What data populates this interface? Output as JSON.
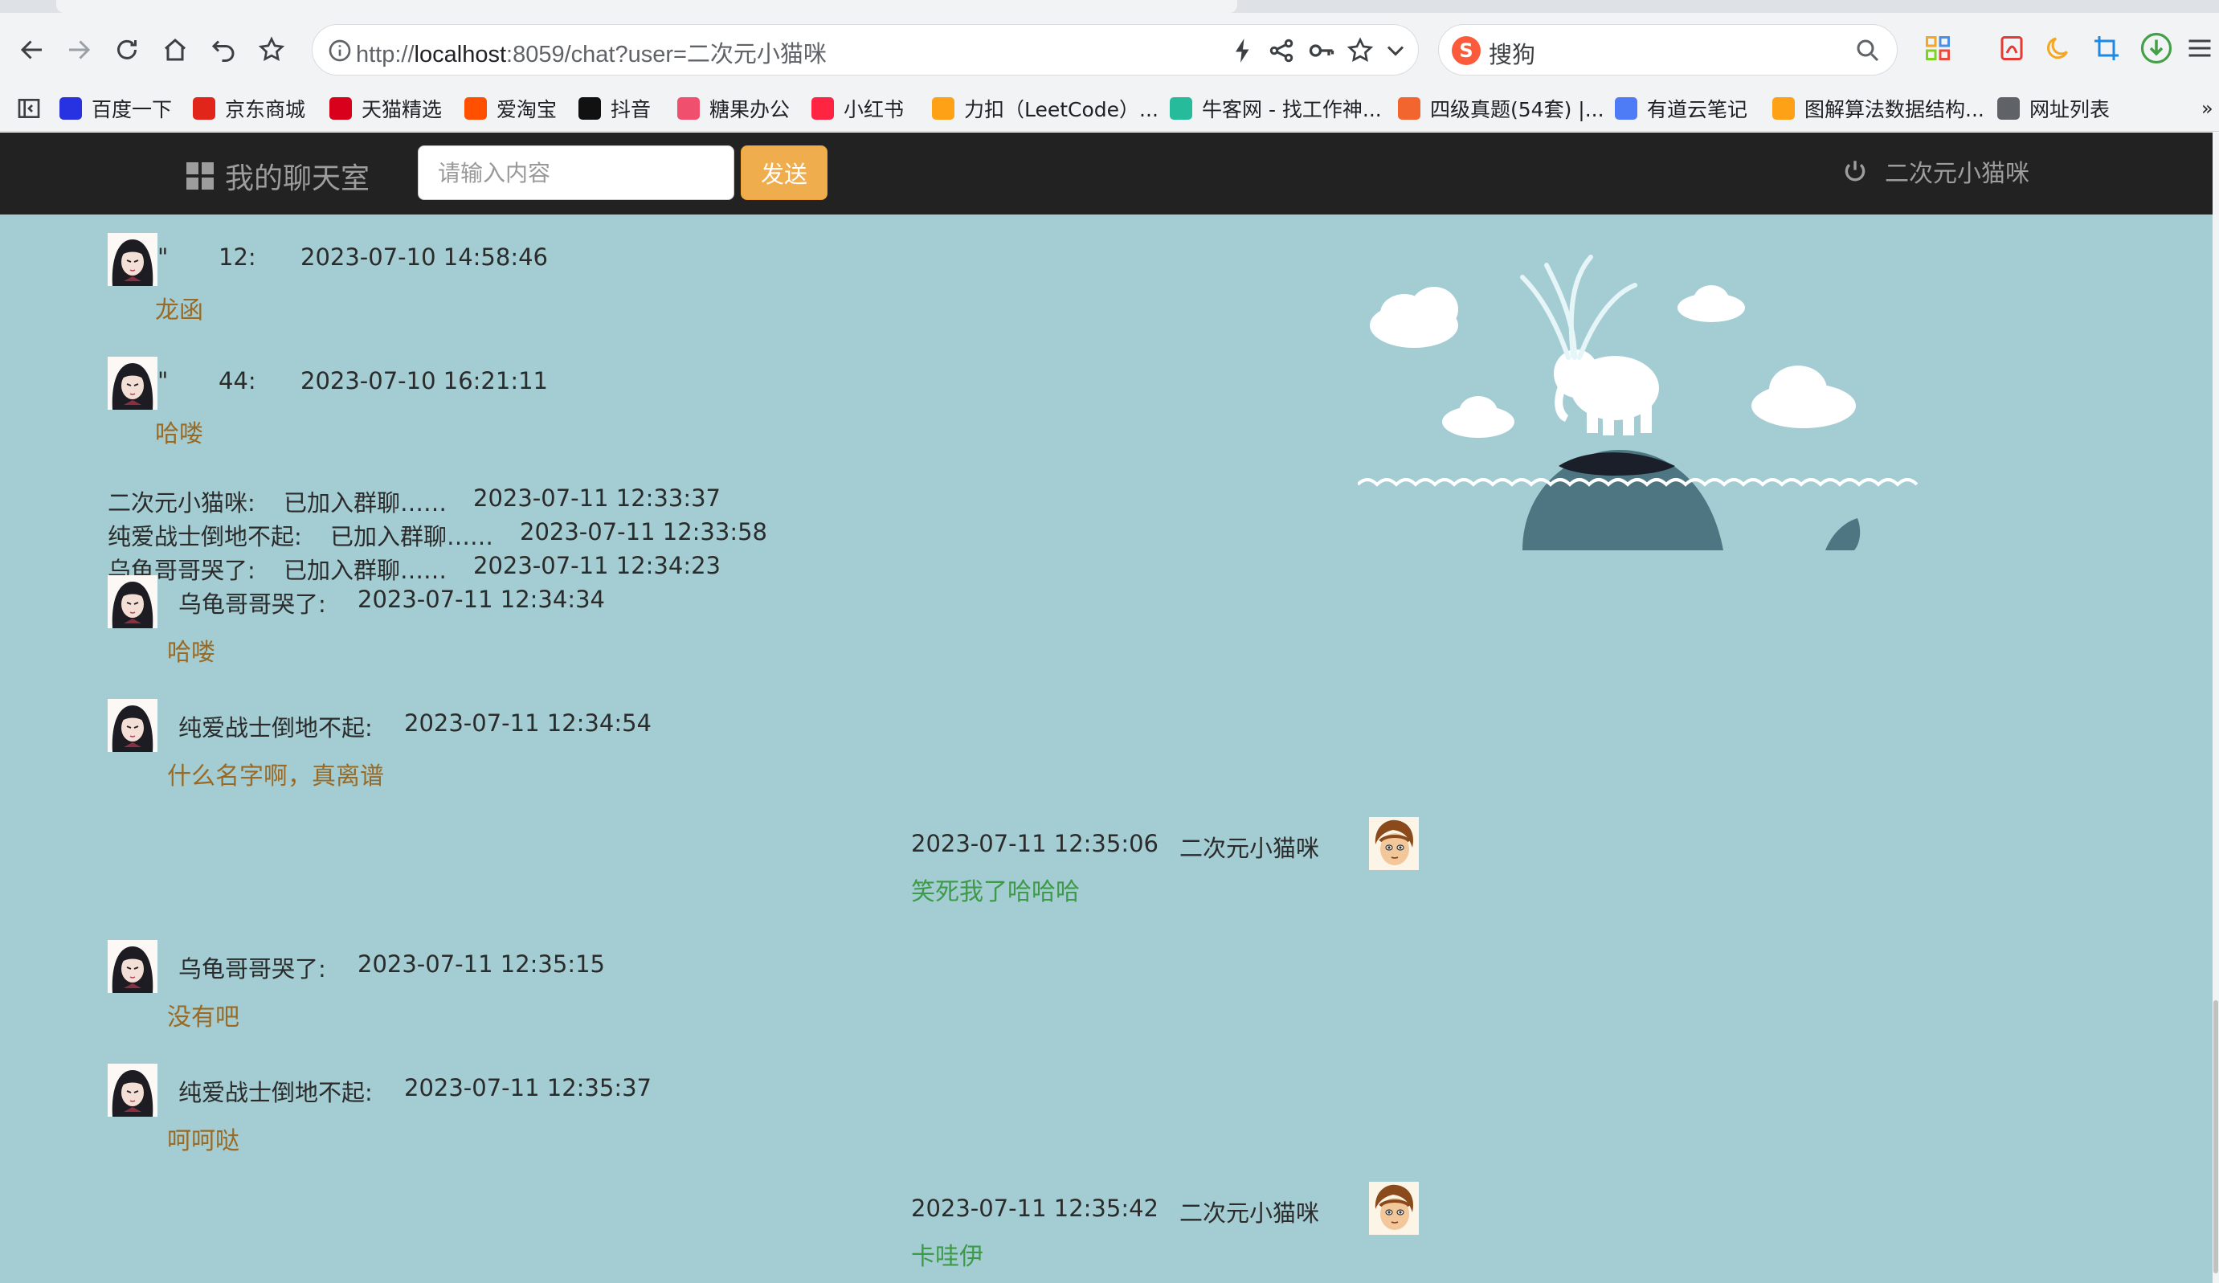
{
  "browser": {
    "url_prefix": "http://",
    "url_host": "localhost",
    "url_rest": ":8059/chat?user=二次元小猫咪",
    "search_placeholder": "搜狗",
    "bookmarks": [
      {
        "label": "百度一下",
        "icon": "baidu-icon",
        "color": "#2932e1"
      },
      {
        "label": "京东商城",
        "icon": "jd-icon",
        "color": "#e1251b"
      },
      {
        "label": "天猫精选",
        "icon": "tmall-icon",
        "color": "#d9001b"
      },
      {
        "label": "爱淘宝",
        "icon": "taobao-icon",
        "color": "#ff5000"
      },
      {
        "label": "抖音",
        "icon": "douyin-icon",
        "color": "#111111"
      },
      {
        "label": "糖果办公",
        "icon": "tangguo-icon",
        "color": "#f0506e"
      },
      {
        "label": "小红书",
        "icon": "xiaohongshu-icon",
        "color": "#ff2442"
      },
      {
        "label": "力扣（LeetCode）...",
        "icon": "leetcode-icon",
        "color": "#ffa116"
      },
      {
        "label": "牛客网 - 找工作神...",
        "icon": "nowcoder-icon",
        "color": "#25bb9b"
      },
      {
        "label": "四级真题(54套) |...",
        "icon": "doc-icon",
        "color": "#f2652f"
      },
      {
        "label": "有道云笔记",
        "icon": "youdao-icon",
        "color": "#4e7cf6"
      },
      {
        "label": "图解算法数据结构...",
        "icon": "leetcode-icon",
        "color": "#ffa116"
      },
      {
        "label": "网址列表",
        "icon": "globe-icon",
        "color": "#5f6368"
      }
    ],
    "bookmarks_more": "»"
  },
  "app": {
    "brand": "我的聊天室",
    "input_placeholder": "请输入内容",
    "send_label": "发送",
    "current_user": "二次元小猫咪"
  },
  "messages": [
    {
      "kind": "other",
      "name": "\"",
      "extra": "12:",
      "time": "2023-07-10 14:58:46",
      "text": "龙函"
    },
    {
      "kind": "other",
      "name": "\"",
      "extra": "44:",
      "time": "2023-07-10 16:21:11",
      "text": "哈喽"
    },
    {
      "kind": "system",
      "name": "二次元小猫咪:",
      "text": "已加入群聊……",
      "time": "2023-07-11 12:33:37"
    },
    {
      "kind": "system",
      "name": "纯爱战士倒地不起:",
      "text": "已加入群聊……",
      "time": "2023-07-11 12:33:58"
    },
    {
      "kind": "system",
      "name": "乌龟哥哥哭了:",
      "text": "已加入群聊……",
      "time": "2023-07-11 12:34:23"
    },
    {
      "kind": "other",
      "name": "乌龟哥哥哭了:",
      "time": "2023-07-11 12:34:34",
      "text": "哈喽"
    },
    {
      "kind": "other",
      "name": "纯爱战士倒地不起:",
      "time": "2023-07-11 12:34:54",
      "text": "什么名字啊，真离谱"
    },
    {
      "kind": "self",
      "name": "二次元小猫咪",
      "time": "2023-07-11 12:35:06",
      "text": "笑死我了哈哈哈"
    },
    {
      "kind": "other",
      "name": "乌龟哥哥哭了:",
      "time": "2023-07-11 12:35:15",
      "text": "没有吧"
    },
    {
      "kind": "other",
      "name": "纯爱战士倒地不起:",
      "time": "2023-07-11 12:35:37",
      "text": "呵呵哒"
    },
    {
      "kind": "self",
      "name": "二次元小猫咪",
      "time": "2023-07-11 12:35:42",
      "text": "卡哇伊"
    }
  ],
  "colors": {
    "navbar": "#222222",
    "content_bg": "#a3cdd2",
    "send_button": "#f0ad4e",
    "other_message_text": "#9a6a25",
    "self_message_text": "#3d9a48"
  }
}
